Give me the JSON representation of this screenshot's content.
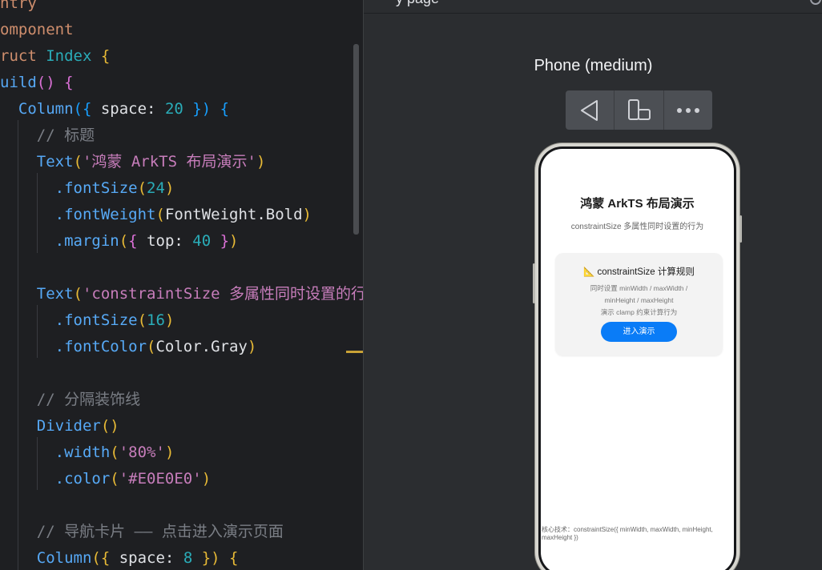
{
  "editor": {
    "lines": [
      [
        [
          "ntry",
          "t-kw"
        ]
      ],
      [
        [
          "omponent",
          "t-kw"
        ]
      ],
      [
        [
          "ruct ",
          "t-kw"
        ],
        [
          "Index ",
          "t-cls"
        ],
        [
          "{",
          "t-brace1"
        ]
      ],
      [
        [
          "uild",
          "t-fn"
        ],
        [
          "() ",
          "t-brace2"
        ],
        [
          "{",
          "t-brace2"
        ]
      ],
      [
        [
          "  ",
          " "
        ],
        [
          "Column",
          "t-comp"
        ],
        [
          "({",
          "t-brace3"
        ],
        [
          " space: ",
          "t-plain"
        ],
        [
          "20",
          "t-num"
        ],
        [
          " })",
          "t-brace3"
        ],
        [
          " {",
          "t-brace3"
        ]
      ],
      [
        [
          "    ",
          " "
        ],
        [
          "// 标题",
          "t-cmt"
        ]
      ],
      [
        [
          "    ",
          " "
        ],
        [
          "Text",
          "t-comp"
        ],
        [
          "(",
          "t-brace1"
        ],
        [
          "'鸿蒙 ArkTS 布局演示'",
          "t-str"
        ],
        [
          ")",
          "t-brace1"
        ]
      ],
      [
        [
          "      ",
          " "
        ],
        [
          ".fontSize",
          "t-method"
        ],
        [
          "(",
          "t-brace1"
        ],
        [
          "24",
          "t-num"
        ],
        [
          ")",
          "t-brace1"
        ]
      ],
      [
        [
          "      ",
          " "
        ],
        [
          ".fontWeight",
          "t-method"
        ],
        [
          "(",
          "t-brace1"
        ],
        [
          "FontWeight.Bold",
          "t-plain"
        ],
        [
          ")",
          "t-brace1"
        ]
      ],
      [
        [
          "      ",
          " "
        ],
        [
          ".margin",
          "t-method"
        ],
        [
          "(",
          "t-brace1"
        ],
        [
          "{",
          "t-brace2"
        ],
        [
          " top: ",
          "t-plain"
        ],
        [
          "40",
          "t-num"
        ],
        [
          " }",
          "t-brace2"
        ],
        [
          ")",
          "t-brace1"
        ]
      ],
      [],
      [
        [
          "    ",
          " "
        ],
        [
          "Text",
          "t-comp"
        ],
        [
          "(",
          "t-brace1"
        ],
        [
          "'constraintSize 多属性同时设置的行",
          "t-str"
        ]
      ],
      [
        [
          "      ",
          " "
        ],
        [
          ".fontSize",
          "t-method"
        ],
        [
          "(",
          "t-brace1"
        ],
        [
          "16",
          "t-num"
        ],
        [
          ")",
          "t-brace1"
        ]
      ],
      [
        [
          "      ",
          " "
        ],
        [
          ".fontColor",
          "t-method"
        ],
        [
          "(",
          "t-brace1"
        ],
        [
          "Color.Gray",
          "t-plain"
        ],
        [
          ")",
          "t-brace1"
        ]
      ],
      [],
      [
        [
          "    ",
          " "
        ],
        [
          "// 分隔装饰线",
          "t-cmt"
        ]
      ],
      [
        [
          "    ",
          " "
        ],
        [
          "Divider",
          "t-comp"
        ],
        [
          "()",
          "t-brace1"
        ]
      ],
      [
        [
          "      ",
          " "
        ],
        [
          ".width",
          "t-method"
        ],
        [
          "(",
          "t-brace1"
        ],
        [
          "'80%'",
          "t-str"
        ],
        [
          ")",
          "t-brace1"
        ]
      ],
      [
        [
          "      ",
          " "
        ],
        [
          ".color",
          "t-method"
        ],
        [
          "(",
          "t-brace1"
        ],
        [
          "'#E0E0E0'",
          "t-str"
        ],
        [
          ")",
          "t-brace1"
        ]
      ],
      [],
      [
        [
          "    ",
          " "
        ],
        [
          "// 导航卡片 —— 点击进入演示页面",
          "t-cmt"
        ]
      ],
      [
        [
          "    ",
          " "
        ],
        [
          "Column",
          "t-comp"
        ],
        [
          "({",
          "t-brace1"
        ],
        [
          " space: ",
          "t-plain"
        ],
        [
          "8",
          "t-num"
        ],
        [
          " })",
          "t-brace1"
        ],
        [
          " {",
          "t-brace1"
        ]
      ]
    ]
  },
  "preview": {
    "topbar_text": "y page",
    "device_name": "Phone (medium)",
    "toolbar_icons": [
      "back-triangle-icon",
      "rotate-device-icon",
      "more-dots-icon"
    ],
    "app": {
      "title": "鸿蒙 ArkTS 布局演示",
      "subtitle": "constraintSize 多属性同时设置的行为",
      "card": {
        "icon": "📐",
        "title": "constraintSize 计算规则",
        "desc_line1": "同时设置 minWidth / maxWidth /",
        "desc_line2": "minHeight / maxHeight",
        "desc_line3": "演示 clamp 约束计算行为",
        "button": "进入演示"
      },
      "footer": "核心技术：constraintSize({ minWidth, maxWidth, minHeight, maxHeight })"
    }
  },
  "colors": {
    "editor_bg": "#1e1f22",
    "preview_bg": "#2b2d30",
    "accent_button": "#0a7cf7"
  }
}
